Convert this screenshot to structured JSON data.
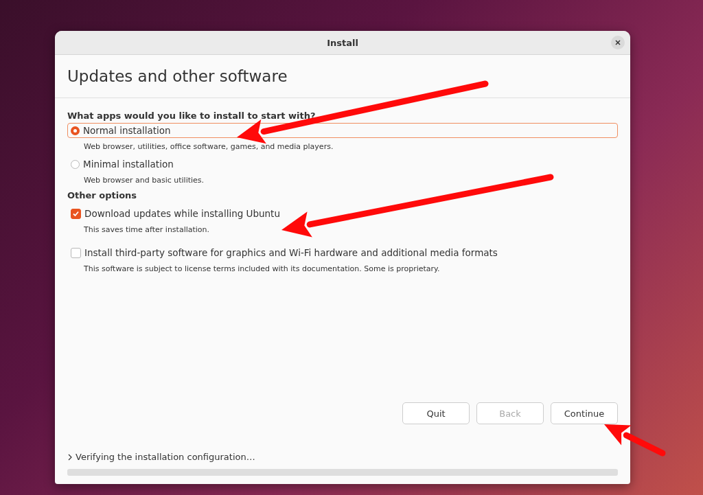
{
  "window": {
    "title": "Install"
  },
  "heading": "Updates and other software",
  "install_question": "What apps would you like to install to start with?",
  "install_options": [
    {
      "label": "Normal installation",
      "description": "Web browser, utilities, office software, games, and media players.",
      "selected": true
    },
    {
      "label": "Minimal installation",
      "description": "Web browser and basic utilities.",
      "selected": false
    }
  ],
  "other_options_heading": "Other options",
  "other_options": [
    {
      "label": "Download updates while installing Ubuntu",
      "description": "This saves time after installation.",
      "checked": true
    },
    {
      "label": "Install third-party software for graphics and Wi-Fi hardware and additional media formats",
      "description": "This software is subject to license terms included with its documentation. Some is proprietary.",
      "checked": false
    }
  ],
  "buttons": [
    {
      "label": "Quit",
      "disabled": false
    },
    {
      "label": "Back",
      "disabled": true
    },
    {
      "label": "Continue",
      "disabled": false
    }
  ],
  "status": {
    "text": "Verifying the installation configuration…",
    "expanded": false
  },
  "progress": {
    "level": 0
  }
}
